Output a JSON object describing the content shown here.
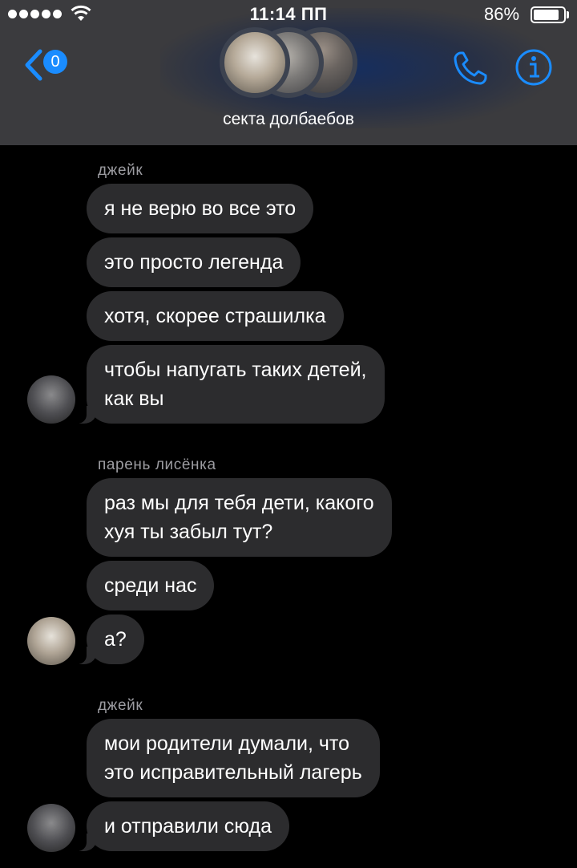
{
  "status_bar": {
    "time": "11:14 ПП",
    "battery_percent": "86%",
    "battery_level": 0.86,
    "signal_bars": 5,
    "wifi_icon": "wifi-icon"
  },
  "header": {
    "back_badge": "0",
    "back_icon": "chevron-left-icon",
    "call_icon": "phone-icon",
    "info_icon": "info-icon",
    "group_name": "секта долбаебов",
    "accent_color": "#1a8cff"
  },
  "messages": [
    {
      "sender": "джейк",
      "bubbles": [
        "я не верю во все это",
        "это просто легенда",
        "хотя, скорее страшилка",
        "чтобы напугать таких детей, как вы"
      ]
    },
    {
      "sender": "парень лисёнка",
      "bubbles": [
        "раз мы для тебя дети, какого хуя ты забыл тут?",
        "среди нас",
        "а?"
      ]
    },
    {
      "sender": "джейк",
      "bubbles": [
        "мои родители думали, что это исправительный лагерь",
        "и отправили сюда"
      ]
    }
  ],
  "bubble_lines": {
    "g0b3": [
      "чтобы напугать таких детей,",
      "как вы"
    ],
    "g1b0": [
      "раз мы для тебя дети, какого",
      "хуя ты забыл тут?"
    ],
    "g2b0": [
      "мои родители думали, что",
      "это исправительный лагерь"
    ]
  }
}
